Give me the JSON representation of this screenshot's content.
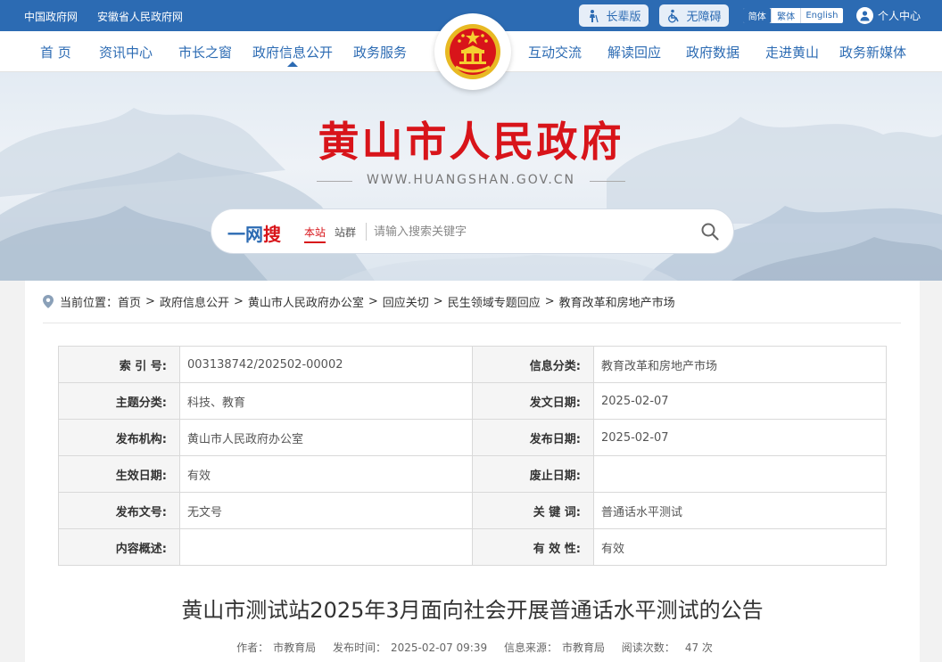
{
  "topbar": {
    "links": [
      "中国政府网",
      "安徽省人民政府网"
    ],
    "elder_mode": "长辈版",
    "accessibility": "无障碍",
    "languages": [
      "简体",
      "繁体",
      "English"
    ],
    "user_center": "个人中心"
  },
  "nav": {
    "left": [
      "首 页",
      "资讯中心",
      "市长之窗",
      "政府信息公开",
      "政务服务"
    ],
    "right": [
      "互动交流",
      "解读回应",
      "政府数据",
      "走进黄山",
      "政务新媒体"
    ],
    "active": "政府信息公开"
  },
  "banner": {
    "title": "黄山市人民政府",
    "url": "WWW.HUANGSHAN.GOV.CN"
  },
  "search": {
    "logo_prefix": "一网",
    "logo_suffix": "搜",
    "tabs": [
      "本站",
      "站群"
    ],
    "placeholder": "请输入搜索关键字"
  },
  "breadcrumb": {
    "prefix": "当前位置：",
    "items": [
      "首页",
      "政府信息公开",
      "黄山市人民政府办公室",
      "回应关切",
      "民生领域专题回应",
      "教育改革和房地产市场"
    ]
  },
  "info_table": [
    [
      {
        "k": "索 引 号:",
        "v": "003138742/202502-00002"
      },
      {
        "k": "信息分类:",
        "v": "教育改革和房地产市场"
      }
    ],
    [
      {
        "k": "主题分类:",
        "v": "科技、教育"
      },
      {
        "k": "发文日期:",
        "v": "2025-02-07"
      }
    ],
    [
      {
        "k": "发布机构:",
        "v": "黄山市人民政府办公室"
      },
      {
        "k": "发布日期:",
        "v": "2025-02-07"
      }
    ],
    [
      {
        "k": "生效日期:",
        "v": "有效"
      },
      {
        "k": "废止日期:",
        "v": ""
      }
    ],
    [
      {
        "k": "发布文号:",
        "v": "无文号"
      },
      {
        "k": "关 键 词:",
        "v": "普通话水平测试"
      }
    ],
    [
      {
        "k": "内容概述:",
        "v": ""
      },
      {
        "k": "有 效 性:",
        "v": "有效"
      }
    ]
  ],
  "article": {
    "title": "黄山市测试站2025年3月面向社会开展普通话水平测试的公告",
    "author_label": "作者：",
    "author": "市教育局",
    "time_label": "发布时间：",
    "time": "2025-02-07 09:39",
    "source_label": "信息来源：",
    "source": "市教育局",
    "reads_label": "阅读次数：",
    "reads": "47 次"
  },
  "colors": {
    "brand_blue": "#2c6bb3",
    "title_red": "#d8141a"
  }
}
